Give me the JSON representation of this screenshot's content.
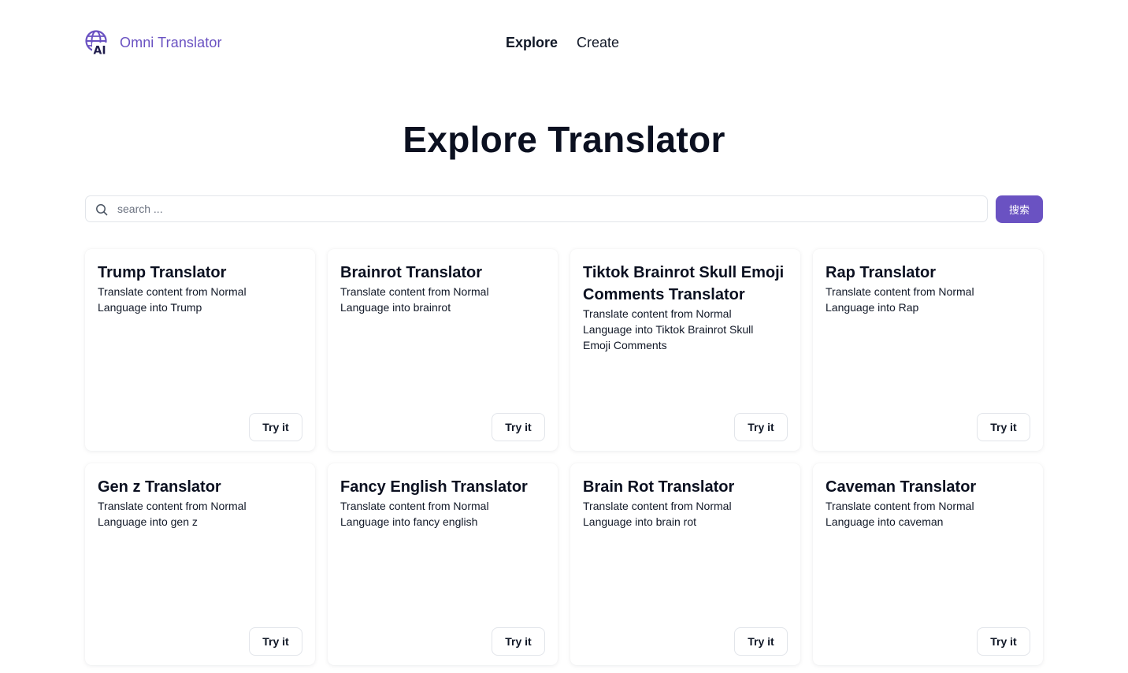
{
  "header": {
    "brand_name": "Omni Translator",
    "logo_text": "AI",
    "nav": [
      {
        "label": "Explore",
        "active": true
      },
      {
        "label": "Create",
        "active": false
      }
    ]
  },
  "main": {
    "title": "Explore Translator",
    "search": {
      "placeholder": "search ...",
      "value": "",
      "button_label": "搜索"
    },
    "cards": [
      {
        "title": "Trump Translator",
        "description": "Translate content from Normal Language into Trump",
        "button_label": "Try it"
      },
      {
        "title": "Brainrot Translator",
        "description": "Translate content from Normal Language into brainrot",
        "button_label": "Try it"
      },
      {
        "title": "Tiktok Brainrot Skull Emoji Comments Translator",
        "description": "Translate content from Normal Language into Tiktok Brainrot Skull Emoji Comments",
        "button_label": "Try it"
      },
      {
        "title": "Rap Translator",
        "description": "Translate content from Normal Language into Rap",
        "button_label": "Try it"
      },
      {
        "title": "Gen z Translator",
        "description": "Translate content from Normal Language into gen z",
        "button_label": "Try it"
      },
      {
        "title": "Fancy English Translator",
        "description": "Translate content from Normal Language into fancy english",
        "button_label": "Try it"
      },
      {
        "title": "Brain Rot Translator",
        "description": "Translate content from Normal Language into brain rot",
        "button_label": "Try it"
      },
      {
        "title": "Caveman Translator",
        "description": "Translate content from Normal Language into caveman",
        "button_label": "Try it"
      }
    ]
  },
  "colors": {
    "accent": "#6a52c2",
    "text": "#0b1020",
    "border": "#e2e5ea",
    "background": "#ffffff"
  },
  "icons": {
    "logo": "globe-ai-icon",
    "search": "search-icon"
  }
}
